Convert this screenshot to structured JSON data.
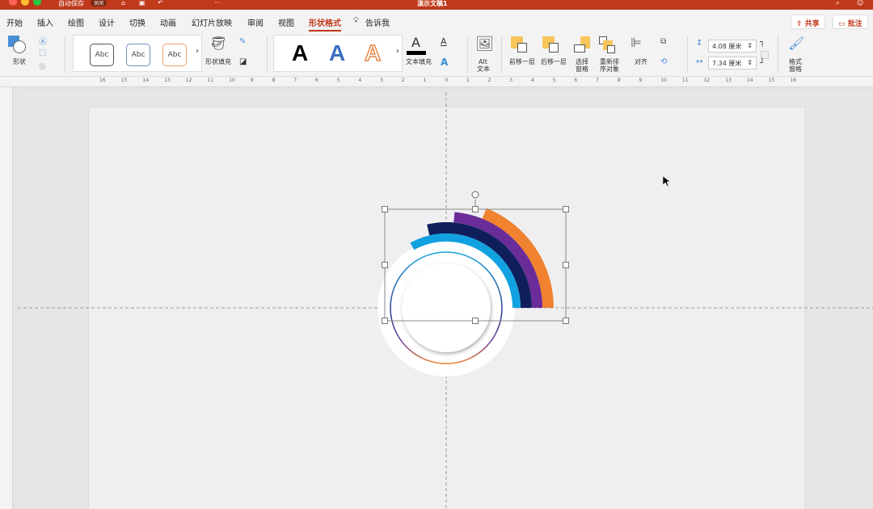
{
  "titlebar": {
    "autosave": "自动保存",
    "autosave_state": "关闭",
    "title": "演示文稿1"
  },
  "tabs": [
    "开始",
    "插入",
    "绘图",
    "设计",
    "切换",
    "动画",
    "幻灯片放映",
    "审阅",
    "视图",
    "形状格式"
  ],
  "active_tab": "形状格式",
  "tell_me": "告诉我",
  "share": "共享",
  "comments": "批注",
  "ribbon": {
    "shape": "形状",
    "shape_styles": [
      "Abc",
      "Abc",
      "Abc"
    ],
    "shape_fill": "形状填充",
    "wordart": [
      "A",
      "A",
      "A"
    ],
    "text_fill": "文本填充",
    "alt_text": "Alt\n文本",
    "alt_text_1": "Alt",
    "alt_text_2": "文本",
    "bring_forward": "前移一层",
    "send_backward": "后移一层",
    "selection_pane_1": "选择",
    "selection_pane_2": "窗格",
    "reorder_1": "重新排",
    "reorder_2": "序对象",
    "align": "对齐",
    "height": "4.08 厘米",
    "width": "7.34 厘米",
    "format_pane_1": "格式",
    "format_pane_2": "窗格"
  },
  "ruler_labels": [
    "16",
    "15",
    "14",
    "13",
    "12",
    "11",
    "10",
    "9",
    "8",
    "7",
    "6",
    "5",
    "4",
    "3",
    "2",
    "1",
    "0",
    "1",
    "2",
    "3",
    "4",
    "5",
    "6",
    "7",
    "8",
    "9",
    "10",
    "11",
    "12",
    "13",
    "14",
    "15",
    "16"
  ],
  "colors": {
    "accent": "#c0391b",
    "arc_blue": "#12a1e0",
    "arc_navy": "#0f1f5c",
    "arc_purple": "#6a2c98",
    "arc_orange": "#f08230"
  },
  "arcs": [
    {
      "name": "orange",
      "end_angle": 68
    },
    {
      "name": "purple",
      "end_angle": 85
    },
    {
      "name": "navy",
      "end_angle": 103
    },
    {
      "name": "blue",
      "end_angle": 119
    }
  ]
}
